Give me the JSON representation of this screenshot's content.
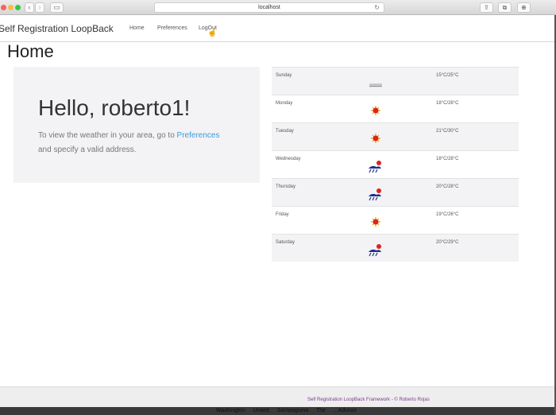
{
  "browser": {
    "url": "localhost",
    "back_icon": "‹",
    "forward_icon": "›",
    "sidebar_icon": "▭",
    "reload_icon": "↻",
    "share_icon": "⇪",
    "tabs_icon": "⧉",
    "downloads_icon": "⊕"
  },
  "navbar": {
    "brand": "Self Registration LoopBack",
    "links": [
      "Home",
      "Preferences",
      "LogOut"
    ]
  },
  "page_title": "Home",
  "greeting": {
    "title": "Hello, roberto1!",
    "text_before": "To view the weather in your area, go to",
    "link": "Preferences",
    "text_after": "and specify a valid address."
  },
  "forecast": [
    {
      "day": "Sunday",
      "icon": "fog-icon",
      "temp": "15°C/25°C"
    },
    {
      "day": "Monday",
      "icon": "sun-icon",
      "temp": "18°C/28°C"
    },
    {
      "day": "Tuesday",
      "icon": "sun-icon",
      "temp": "21°C/30°C"
    },
    {
      "day": "Wednesday",
      "icon": "rain-sun-icon",
      "temp": "18°C/28°C"
    },
    {
      "day": "Thursday",
      "icon": "rain-sun-icon",
      "temp": "20°C/28°C"
    },
    {
      "day": "Friday",
      "icon": "sun-icon",
      "temp": "19°C/26°C"
    },
    {
      "day": "Saturday",
      "icon": "rain-sun-icon",
      "temp": "20°C/29°C"
    }
  ],
  "footer": "Self Registration LoopBack Framework - © Roberto Rojas",
  "below_content": "Washington United Sampaguina The ...Advisor",
  "colors": {
    "link": "#3b9ad9",
    "footer_text": "#7a3d8c",
    "panel": "#f3f3f5"
  }
}
